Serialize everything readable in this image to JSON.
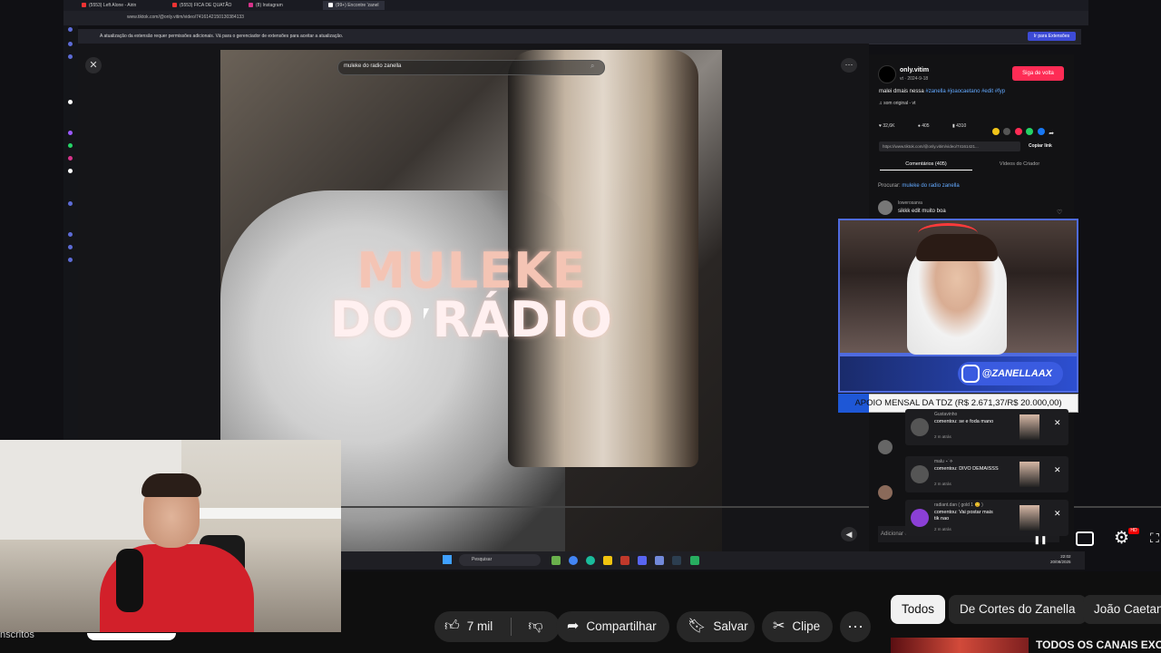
{
  "browser": {
    "tabs": [
      "(5553) Left Alone - Airin",
      "(5553) FICA DE QUATÃO",
      "(8) Instagram",
      "(99+) Encontre 'zanel"
    ],
    "url": "www.tiktok.com/@only.vitim/video/7416142150130384133",
    "notice": "A atualização da extensão requer permissões adicionais. Vá para o gerenciador de extensões para aceitar a atualização.",
    "notice_button": "Ir para Extensões"
  },
  "tiktok": {
    "search_value": "muleke do radio zanella",
    "video_overlay_line1": "MULEKE",
    "video_overlay_line2": "DO RÁDIO",
    "username": "only.vitim",
    "date": "vt · 2024-9-18",
    "follow_label": "Siga de volta",
    "caption_text": "malei dmais nessa ",
    "caption_tags": "#zanella #joaocaetano #edit #fyp",
    "sound": "som original - vt",
    "likes": "32,6K",
    "comments": "405",
    "saves": "4310",
    "link": "https://www.tiktok.com/@only.vitim/video/74161421...",
    "copy_link": "Copiar link",
    "tab_comments": "Comentários (405)",
    "tab_videos": "Vídeos do Criador",
    "search_hint_label": "Procurar: ",
    "search_hint_value": "muleke do radio zanella",
    "comment1_user": "lowerosarva",
    "comment1_text": "sikkk edit muito boa",
    "add_comment": "Adicionar comentário..."
  },
  "stream_overlay": {
    "instagram_handle": "@ZANELLAAX",
    "goal_text": "APOIO MENSAL DA TDZ (R$ 2.671,37/R$ 20.000,00)",
    "goal_progress": 0.13
  },
  "notifications": [
    {
      "user": "Gustavinho",
      "line1": "comentou: se e foda mano",
      "line2": "",
      "time": "2 m atrás"
    },
    {
      "user": "malu ⋆˙⟡",
      "line1": "comentou: DIVO DEMAISSS",
      "line2": "",
      "time": "2 m atrás"
    },
    {
      "user": "radiant.dan ( gold 1 😊 )",
      "line1": "comentou: Vai postar mais",
      "line2": "tik nao",
      "time": "2 m atrás"
    }
  ],
  "taskbar": {
    "search_placeholder": "Pesquisar",
    "time": "22:02",
    "date": "20/08/2025"
  },
  "youtube": {
    "subscribers_fragment": "nscritos",
    "like_count": "7 mil",
    "share_label": "Compartilhar",
    "save_label": "Salvar",
    "clip_label": "Clipe",
    "more_label": "⋯",
    "hd_badge": "HD",
    "chips": [
      "Todos",
      "De Cortes do Zanella",
      "João Caetano"
    ],
    "rec_title": "TODOS OS CANAIS EXCLUSIVOS"
  },
  "colors": {
    "tiktok_red": "#fe2c55",
    "link_blue": "#63a9ff",
    "stream_blue": "#2d4fd1"
  },
  "icons": {
    "like": "thumbs-up-icon",
    "dislike": "thumbs-down-icon",
    "share": "share-arrow-icon",
    "save": "bookmark-icon",
    "clip": "scissors-icon",
    "settings": "gear-icon",
    "captions": "cc-icon"
  }
}
